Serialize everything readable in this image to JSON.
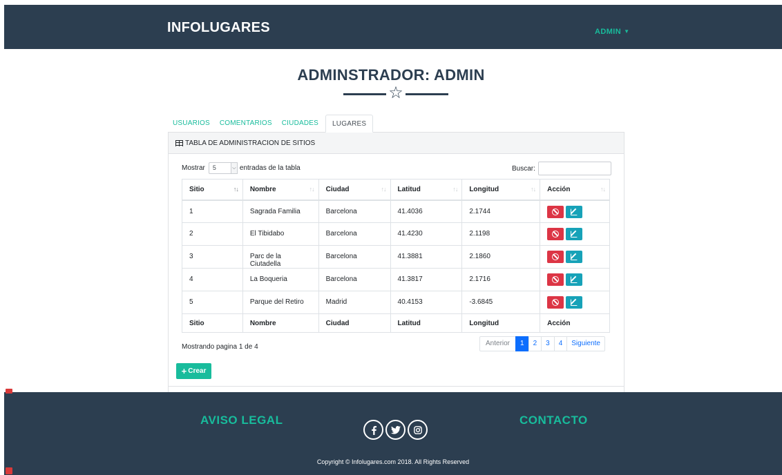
{
  "navbar": {
    "brand": "INFOLUGARES",
    "user_menu": "ADMIN"
  },
  "page": {
    "title": "ADMINSTRADOR: ADMIN"
  },
  "tabs": [
    {
      "label": "USUARIOS",
      "active": false
    },
    {
      "label": "COMENTARIOS",
      "active": false
    },
    {
      "label": "CIUDADES",
      "active": false
    },
    {
      "label": "LUGARES",
      "active": true
    }
  ],
  "card": {
    "header": "TABLA DE ADMINISTRACION DE SITIOS",
    "show_label": "Mostrar",
    "page_size": "5",
    "entries_label": "entradas de la tabla",
    "search_label": "Buscar:",
    "search_value": "",
    "columns": [
      "Sitio",
      "Nombre",
      "Ciudad",
      "Latitud",
      "Longitud",
      "Acción"
    ],
    "rows": [
      [
        "1",
        "Sagrada Familia",
        "Barcelona",
        "41.4036",
        "2.1744"
      ],
      [
        "2",
        "El Tibidabo",
        "Barcelona",
        "41.4230",
        "2.1198"
      ],
      [
        "3",
        "Parc de la Ciutadella",
        "Barcelona",
        "41.3881",
        "2.1860"
      ],
      [
        "4",
        "La Boqueria",
        "Barcelona",
        "41.3817",
        "2.1716"
      ],
      [
        "5",
        "Parque del Retiro",
        "Madrid",
        "40.4153",
        "-3.6845"
      ]
    ],
    "info": "Mostrando pagina 1 de 4",
    "pagination": {
      "prev": "Anterior",
      "pages": [
        "1",
        "2",
        "3",
        "4"
      ],
      "current": "1",
      "next": "Siguiente"
    },
    "create_label": "Crear"
  },
  "footer": {
    "left_title": "AVISO LEGAL",
    "right_title": "CONTACTO",
    "social": [
      "facebook-icon",
      "twitter-icon",
      "instagram-icon"
    ],
    "copyright": "Copyright © Infolugares.com 2018. All Rights Reserved"
  },
  "colors": {
    "navy": "#2c3e50",
    "accent": "#18bc9c",
    "danger": "#dc3545",
    "info": "#17a2b8",
    "primary": "#0d6efd"
  }
}
